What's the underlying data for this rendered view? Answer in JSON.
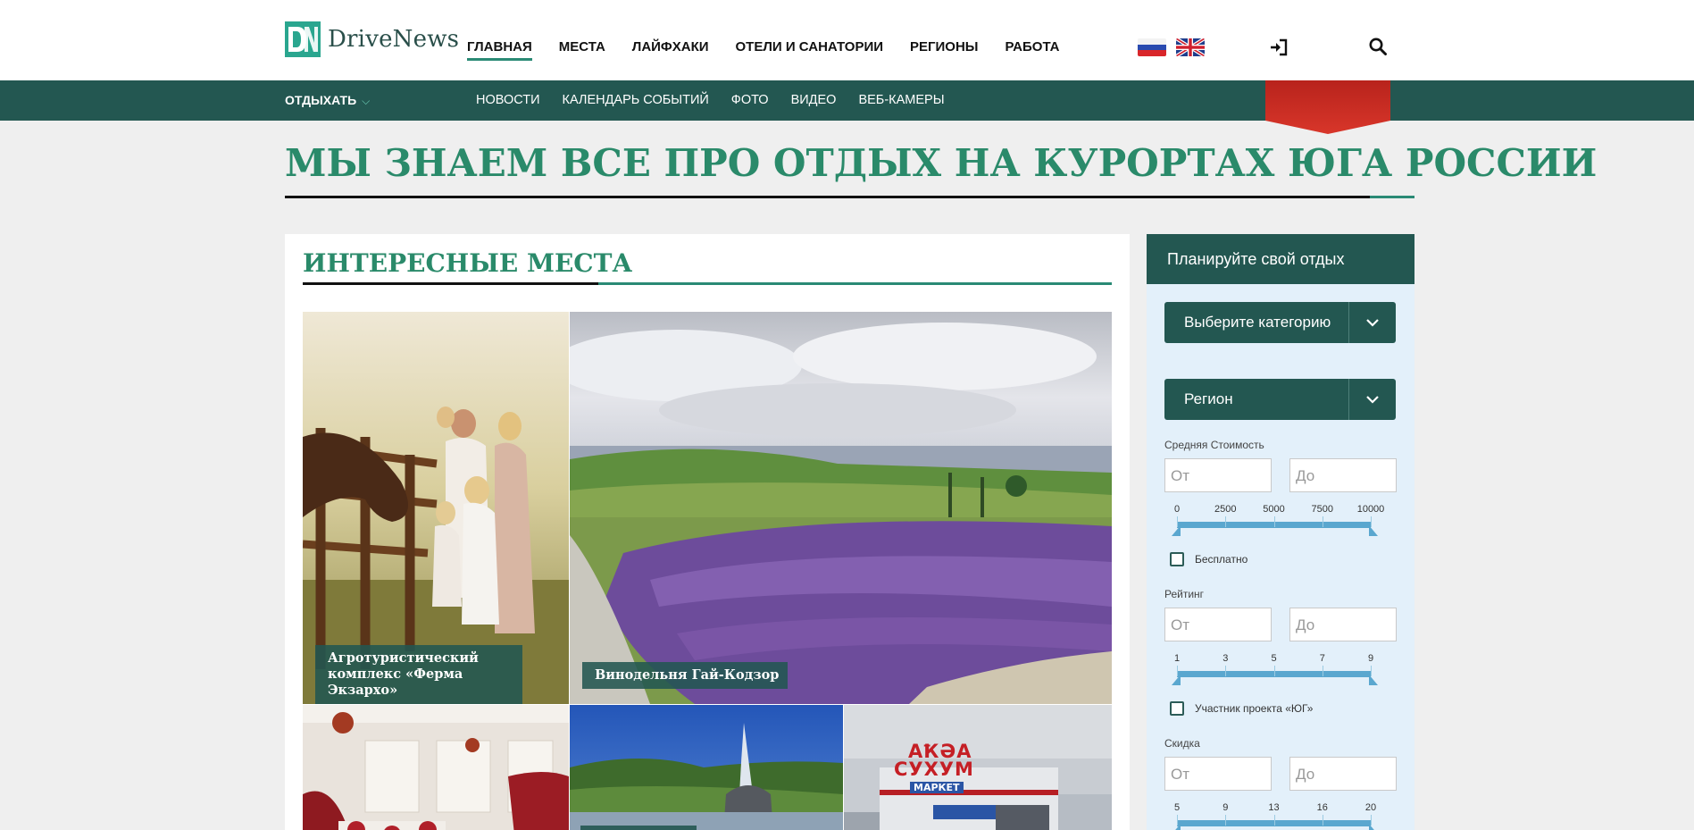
{
  "brand": {
    "name": "DriveNews",
    "logo_letters": "DN"
  },
  "main_nav": [
    {
      "label": "ГЛАВНАЯ",
      "active": true
    },
    {
      "label": "МЕСТА",
      "active": false
    },
    {
      "label": "ЛАЙФХАКИ",
      "active": false
    },
    {
      "label": "ОТЕЛИ И САНАТОРИИ",
      "active": false
    },
    {
      "label": "РЕГИОНЫ",
      "active": false
    },
    {
      "label": "РАБОТА",
      "active": false
    }
  ],
  "languages": [
    "ru-flag-icon",
    "uk-flag-icon"
  ],
  "header_icons": [
    "login-icon",
    "search-icon"
  ],
  "sub_nav": {
    "rest_label": "ОТДЫХАТЬ",
    "items": [
      "НОВОСТИ",
      "КАЛЕНДАРЬ СОБЫТИЙ",
      "ФОТО",
      "ВИДЕО",
      "ВЕБ-КАМЕРЫ"
    ]
  },
  "hero": {
    "title": "МЫ ЗНАЕМ ВСЕ ПРО ОТДЫХ НА КУРОРТАХ ЮГА РОССИИ"
  },
  "places": {
    "title": "ИНТЕРЕСНЫЕ МЕСТА",
    "tiles": [
      {
        "caption_line1": "Агротуристический",
        "caption_line2": "комплекс «Ферма Экзархо»"
      },
      {
        "caption_line1": "Винодельня Гай-Кодзор",
        "caption_line2": ""
      },
      {
        "caption_line1": "",
        "caption_line2": ""
      },
      {
        "caption_line1": "",
        "caption_line2": ""
      },
      {
        "caption_line1": "",
        "caption_line2": ""
      }
    ],
    "store_sign_1": "АҞӘА",
    "store_sign_2": "СУХУМ",
    "store_sign_3": "МАРКЕТ"
  },
  "sidebar": {
    "title": "Планируйте свой отдых",
    "category_select": "Выберите категорию",
    "region_select": "Регион",
    "price": {
      "label": "Средняя Стоимость",
      "from_placeholder": "От",
      "to_placeholder": "До",
      "scale": [
        "0",
        "2500",
        "5000",
        "7500",
        "10000"
      ],
      "range": [
        0,
        10000
      ]
    },
    "free_label": "Бесплатно",
    "rating": {
      "label": "Рейтинг",
      "from_placeholder": "От",
      "to_placeholder": "До",
      "scale": [
        "1",
        "3",
        "5",
        "7",
        "9"
      ],
      "range": [
        1,
        9
      ]
    },
    "member_label": "Участник проекта «ЮГ»",
    "discount": {
      "label": "Скидка",
      "from_placeholder": "От",
      "to_placeholder": "До",
      "scale": [
        "5",
        "9",
        "13",
        "16",
        "20"
      ],
      "range": [
        5,
        20
      ]
    }
  },
  "colors": {
    "brand_dark": "#235751",
    "accent_green": "#2a8a6a",
    "slider": "#5aa7cf"
  }
}
